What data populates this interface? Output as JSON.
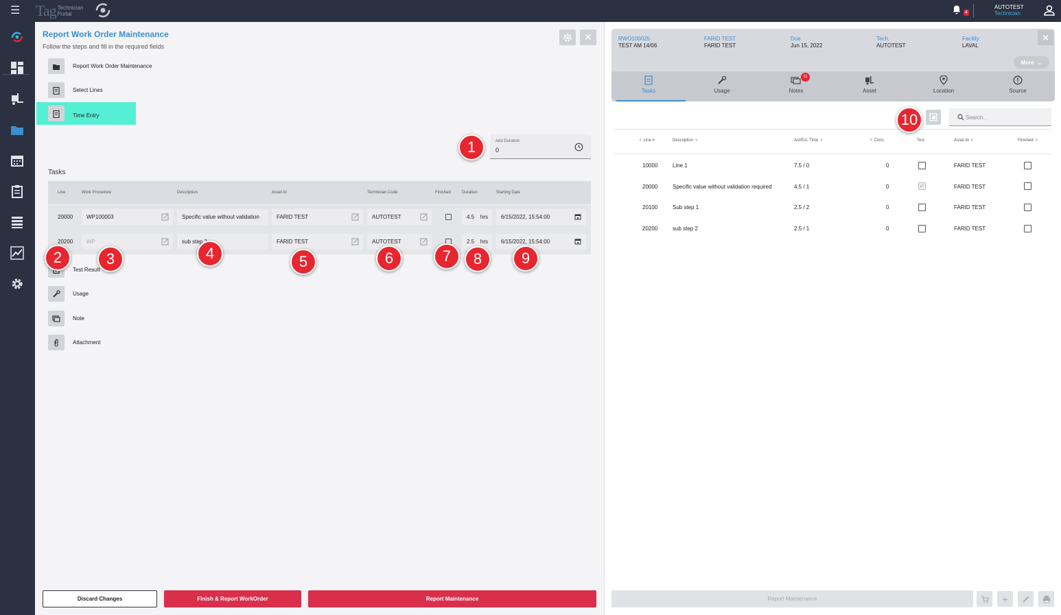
{
  "topbar": {
    "logo_tag": "Tag",
    "logo_line1": "Technician",
    "logo_line2": "Portal",
    "notification_count": "4",
    "user_name": "AUTOTEST",
    "user_role": "Technician"
  },
  "sidebar": {
    "icons": [
      "logo-swirl-icon",
      "dashboard-icon",
      "forklift-icon",
      "folder-icon",
      "calendar-icon",
      "clipboard-icon",
      "list-icon",
      "chart-icon",
      "gear-icon"
    ]
  },
  "left": {
    "title": "Report Work Order Maintenance",
    "subtitle": "Follow the steps and fill in the required fields",
    "steps": [
      {
        "label": "Report Work Order Maintenance",
        "icon": "folder-icon"
      },
      {
        "label": "Select Lines",
        "icon": "clipboard-icon"
      },
      {
        "label": "Time Entry",
        "icon": "clipboard-icon"
      }
    ],
    "steps_lower": [
      {
        "label": "Test Result",
        "icon": "check-doc-icon"
      },
      {
        "label": "Usage",
        "icon": "wrench-icon"
      },
      {
        "label": "Note",
        "icon": "note-icon"
      },
      {
        "label": "Attachment",
        "icon": "paperclip-icon"
      }
    ],
    "add_duration": {
      "label": "Add Duration",
      "value": "0"
    },
    "tasks_label": "Tasks",
    "task_columns": [
      "Line",
      "Work Procedure",
      "Description",
      "Asset Id",
      "Technician Code",
      "Finished",
      "Duration",
      "Starting Date"
    ],
    "tasks": [
      {
        "line": "20000",
        "work_procedure": "WP100003",
        "description": "Specific value without validation",
        "asset_id": "FARID TEST",
        "technician_code": "AUTOTEST",
        "finished": false,
        "duration": "4.5",
        "unit": "hrs",
        "starting_date": "6/15/2022, 15:54:00"
      },
      {
        "line": "20200",
        "work_procedure": "WP",
        "description": "sub step 2",
        "asset_id": "FARID TEST",
        "technician_code": "AUTOTEST",
        "finished": false,
        "duration": "2.5",
        "unit": "hrs",
        "starting_date": "6/15/2022, 15:54:00"
      }
    ],
    "buttons": {
      "discard": "Discard Changes",
      "finish": "Finish & Report WorkOrder",
      "report": "Report Maintenance"
    }
  },
  "callouts": [
    "1",
    "2",
    "3",
    "4",
    "5",
    "6",
    "7",
    "8",
    "9",
    "10"
  ],
  "right": {
    "header": [
      {
        "key": "RWO100025",
        "value": "TEST AM 14/06"
      },
      {
        "key": "FARID TEST",
        "value": "FARID TEST"
      },
      {
        "key": "Due",
        "value": "Jun 15, 2022"
      },
      {
        "key": "Tech.",
        "value": "AUTOTEST"
      },
      {
        "key": "Facility",
        "value": "LAVAL"
      }
    ],
    "more_label": "More",
    "tabs": [
      {
        "label": "Tasks",
        "icon": "clipboard-icon",
        "active": true
      },
      {
        "label": "Usage",
        "icon": "wrench-icon"
      },
      {
        "label": "Notes",
        "icon": "note-icon",
        "badge": "11"
      },
      {
        "label": "Asset",
        "icon": "forklift-icon"
      },
      {
        "label": "Location",
        "icon": "pin-icon"
      },
      {
        "label": "Source",
        "icon": "info-icon"
      }
    ],
    "search_placeholder": "Search...",
    "columns": [
      "Line #",
      "Description",
      "Act/Est. Time",
      "Cons.",
      "Test",
      "Asset Id",
      "Finished"
    ],
    "rows": [
      {
        "line": "10000",
        "description": "Line 1",
        "time": "7.5 / 0",
        "cons": "0",
        "test": false,
        "asset": "FARID TEST",
        "finished": false
      },
      {
        "line": "20000",
        "description": "Specific value without validation required",
        "time": "4.5 / 1",
        "cons": "0",
        "test": true,
        "asset": "FARID TEST",
        "finished": false
      },
      {
        "line": "20100",
        "description": "Sub step 1",
        "time": "2.5 / 2",
        "cons": "0",
        "test": false,
        "asset": "FARID TEST",
        "finished": false
      },
      {
        "line": "20200",
        "description": "sub step 2",
        "time": "2.5 / 1",
        "cons": "0",
        "test": false,
        "asset": "FARID TEST",
        "finished": false
      }
    ],
    "report_button": "Report Maintenance",
    "footer_icons": [
      "cart-icon",
      "plus-icon",
      "pencil-icon",
      "printer-icon"
    ]
  },
  "colors": {
    "accent": "#3a8fcf",
    "active_step": "#55efd6",
    "primary_button": "#d92f4b",
    "callout": "#e8262f",
    "nav": "#2b3140"
  }
}
